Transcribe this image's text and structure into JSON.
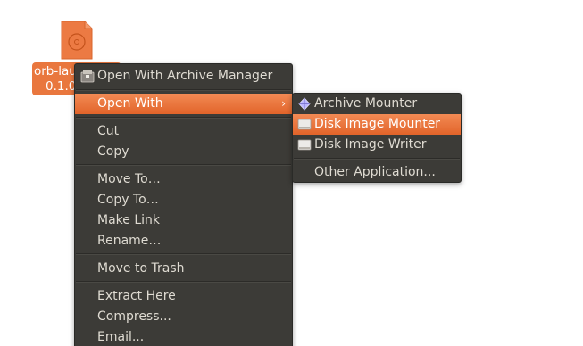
{
  "desktop_file": {
    "label_line1": "orb-lau",
    "label_line2": "0.1.0",
    "icon": "disc-image-file-icon"
  },
  "context_menu": {
    "items": [
      {
        "label": "Open With Archive Manager",
        "icon": "archive-manager-icon"
      },
      {
        "label": "Open With",
        "submenu_arrow": "›"
      },
      {
        "label": "Cut"
      },
      {
        "label": "Copy"
      },
      {
        "label": "Move To…"
      },
      {
        "label": "Copy To…"
      },
      {
        "label": "Make Link"
      },
      {
        "label": "Rename…"
      },
      {
        "label": "Move to Trash"
      },
      {
        "label": "Extract Here"
      },
      {
        "label": "Compress..."
      },
      {
        "label": "Email..."
      }
    ]
  },
  "open_with_submenu": {
    "items": [
      {
        "label": "Archive Mounter",
        "icon": "archive-mounter-icon"
      },
      {
        "label": "Disk Image Mounter",
        "icon": "disk-image-mounter-icon"
      },
      {
        "label": "Disk Image Writer",
        "icon": "disk-image-writer-icon"
      },
      {
        "label": "Other Application..."
      }
    ]
  },
  "colors": {
    "accent": "#e9773e",
    "menu_bg": "#3c3b37",
    "menu_text": "#dfdbd2"
  }
}
